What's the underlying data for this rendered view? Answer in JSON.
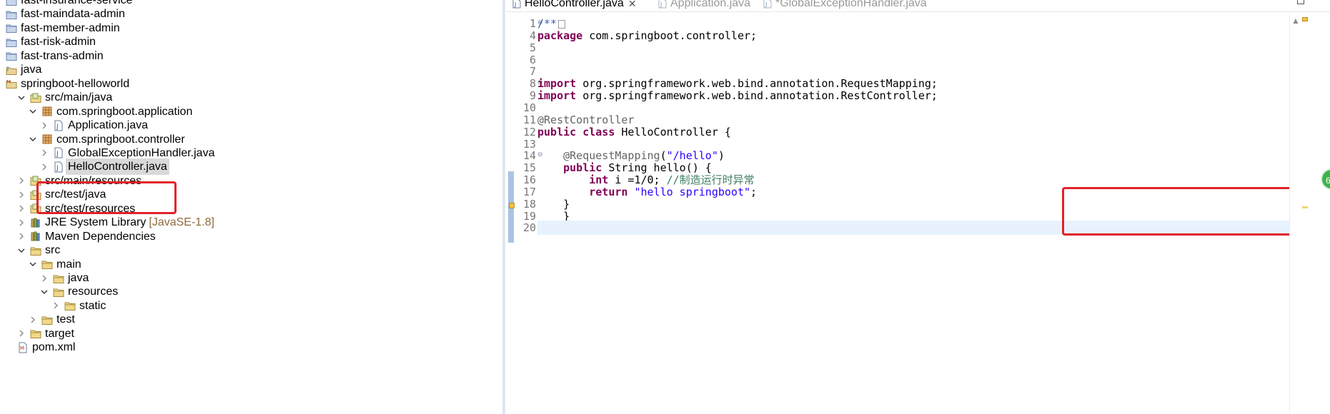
{
  "explorer": {
    "items": [
      {
        "label": "fast-insurance-service",
        "icon": "project-folder-icon",
        "expanded": null
      },
      {
        "label": "fast-maindata-admin",
        "icon": "project-folder-icon",
        "expanded": null
      },
      {
        "label": "fast-member-admin",
        "icon": "project-folder-icon",
        "expanded": null
      },
      {
        "label": "fast-risk-admin",
        "icon": "project-folder-icon",
        "expanded": null
      },
      {
        "label": "fast-trans-admin",
        "icon": "project-folder-icon",
        "expanded": null
      },
      {
        "label": "java",
        "icon": "java-project-icon",
        "expanded": null
      },
      {
        "label": "springboot-helloworld",
        "icon": "maven-project-icon",
        "expanded": null
      },
      {
        "label": "src/main/java",
        "icon": "source-folder-icon",
        "expanded": true
      },
      {
        "label": "com.springboot.application",
        "icon": "package-icon",
        "expanded": true
      },
      {
        "label": "Application.java",
        "icon": "java-file-icon",
        "expanded": false
      },
      {
        "label": "com.springboot.controller",
        "icon": "package-icon",
        "expanded": true
      },
      {
        "label": "GlobalExceptionHandler.java",
        "icon": "java-file-icon",
        "expanded": false
      },
      {
        "label": "HelloController.java",
        "icon": "java-file-icon",
        "expanded": false,
        "selected": true
      },
      {
        "label": "src/main/resources",
        "icon": "source-folder-icon",
        "expanded": false
      },
      {
        "label": "src/test/java",
        "icon": "source-folder-icon",
        "expanded": false
      },
      {
        "label": "src/test/resources",
        "icon": "source-folder-icon",
        "expanded": false
      },
      {
        "label": "JRE System Library",
        "suffix": "[JavaSE-1.8]",
        "icon": "library-icon",
        "expanded": false
      },
      {
        "label": "Maven Dependencies",
        "icon": "library-icon",
        "expanded": false
      },
      {
        "label": "src",
        "icon": "folder-icon",
        "expanded": true
      },
      {
        "label": "main",
        "icon": "folder-icon",
        "expanded": true
      },
      {
        "label": "java",
        "icon": "folder-icon",
        "expanded": false
      },
      {
        "label": "resources",
        "icon": "folder-icon",
        "expanded": true
      },
      {
        "label": "static",
        "icon": "folder-icon",
        "expanded": false
      },
      {
        "label": "test",
        "icon": "folder-icon",
        "expanded": false
      },
      {
        "label": "target",
        "icon": "folder-icon",
        "expanded": false
      },
      {
        "label": "pom.xml",
        "icon": "xml-file-icon",
        "expanded": null
      }
    ]
  },
  "editor": {
    "tabs": [
      {
        "label": "HelloController.java",
        "active": true,
        "close": "✕"
      },
      {
        "label": "Application.java",
        "active": false
      },
      {
        "label": "*GlobalExceptionHandler.java",
        "active": false
      }
    ],
    "badge_text": "6",
    "lines": [
      {
        "no": "1",
        "fold": "⊕",
        "tokens": [
          {
            "t": "/**",
            "c": "jdoc"
          }
        ],
        "collapsed": true
      },
      {
        "no": "4",
        "tokens": [
          {
            "t": "package",
            "c": "kw"
          },
          {
            "t": " com.springboot.controller;",
            "c": ""
          }
        ]
      },
      {
        "no": "5",
        "tokens": []
      },
      {
        "no": "6",
        "tokens": []
      },
      {
        "no": "7",
        "tokens": []
      },
      {
        "no": "8",
        "fold": "⊖",
        "tokens": [
          {
            "t": "import",
            "c": "kw"
          },
          {
            "t": " org.springframework.web.bind.annotation.RequestMapping;",
            "c": ""
          }
        ]
      },
      {
        "no": "9",
        "tokens": [
          {
            "t": "import",
            "c": "kw"
          },
          {
            "t": " org.springframework.web.bind.annotation.RestController;",
            "c": ""
          }
        ]
      },
      {
        "no": "10",
        "tokens": []
      },
      {
        "no": "11",
        "tokens": [
          {
            "t": "@RestController",
            "c": "ann"
          }
        ]
      },
      {
        "no": "12",
        "tokens": [
          {
            "t": "public",
            "c": "kw"
          },
          {
            "t": " ",
            "c": ""
          },
          {
            "t": "class",
            "c": "kw"
          },
          {
            "t": " HelloController {",
            "c": ""
          }
        ]
      },
      {
        "no": "13",
        "tokens": []
      },
      {
        "no": "14",
        "fold": "⊖",
        "tokens": [
          {
            "t": "    ",
            "c": ""
          },
          {
            "t": "@RequestMapping",
            "c": "ann"
          },
          {
            "t": "(",
            "c": ""
          },
          {
            "t": "\"/hello\"",
            "c": "str"
          },
          {
            "t": ")",
            "c": ""
          }
        ]
      },
      {
        "no": "15",
        "tokens": [
          {
            "t": "    ",
            "c": ""
          },
          {
            "t": "public",
            "c": "kw"
          },
          {
            "t": " String hello() {",
            "c": ""
          }
        ]
      },
      {
        "no": "16",
        "tokens": [
          {
            "t": "        ",
            "c": ""
          },
          {
            "t": "int",
            "c": "kw"
          },
          {
            "t": " i =1/0; ",
            "c": ""
          },
          {
            "t": "//制造运行时异常",
            "c": "cmt"
          }
        ]
      },
      {
        "no": "17",
        "tokens": [
          {
            "t": "        ",
            "c": ""
          },
          {
            "t": "return",
            "c": "kw"
          },
          {
            "t": " ",
            "c": ""
          },
          {
            "t": "\"hello springboot\"",
            "c": "str"
          },
          {
            "t": ";",
            "c": ""
          }
        ]
      },
      {
        "no": "18",
        "tokens": [
          {
            "t": "    }",
            "c": ""
          }
        ]
      },
      {
        "no": "19",
        "tokens": [
          {
            "t": "    }",
            "c": ""
          }
        ]
      },
      {
        "no": "20",
        "tokens": [],
        "current": true
      }
    ]
  },
  "colors": {
    "highlight_box": "#e2222b",
    "keyword": "#7f0055",
    "string": "#2a00ff",
    "comment": "#3f7f5f",
    "annotation": "#646464",
    "selection": "#d9d9d9",
    "current_line": "#e8f2fe"
  }
}
